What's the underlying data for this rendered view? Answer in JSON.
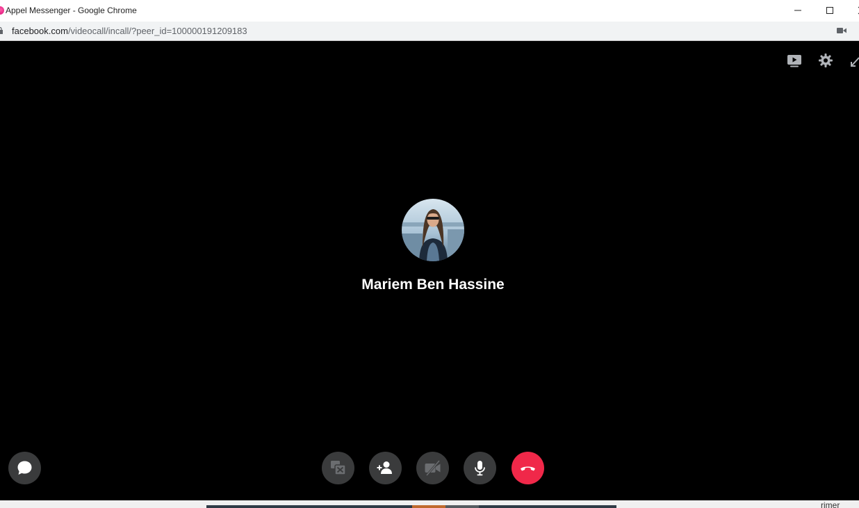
{
  "window": {
    "title": "Appel Messenger - Google Chrome"
  },
  "addressbar": {
    "url_host": "facebook.com",
    "url_path": "/videocall/incall/?peer_id=100000191209183"
  },
  "call": {
    "caller_name": "Mariem Ben Hassine",
    "top_icons": [
      "picture-in-picture-icon",
      "gear-icon",
      "fullscreen-icon"
    ],
    "controls": [
      "chat-icon",
      "screen-share-off-icon",
      "add-person-icon",
      "video-off-icon",
      "microphone-icon",
      "end-call-icon"
    ],
    "end_call_color": "#f02849",
    "control_bg_color": "#3a3b3c"
  },
  "taskbar": {
    "partial_text": "rimer"
  }
}
